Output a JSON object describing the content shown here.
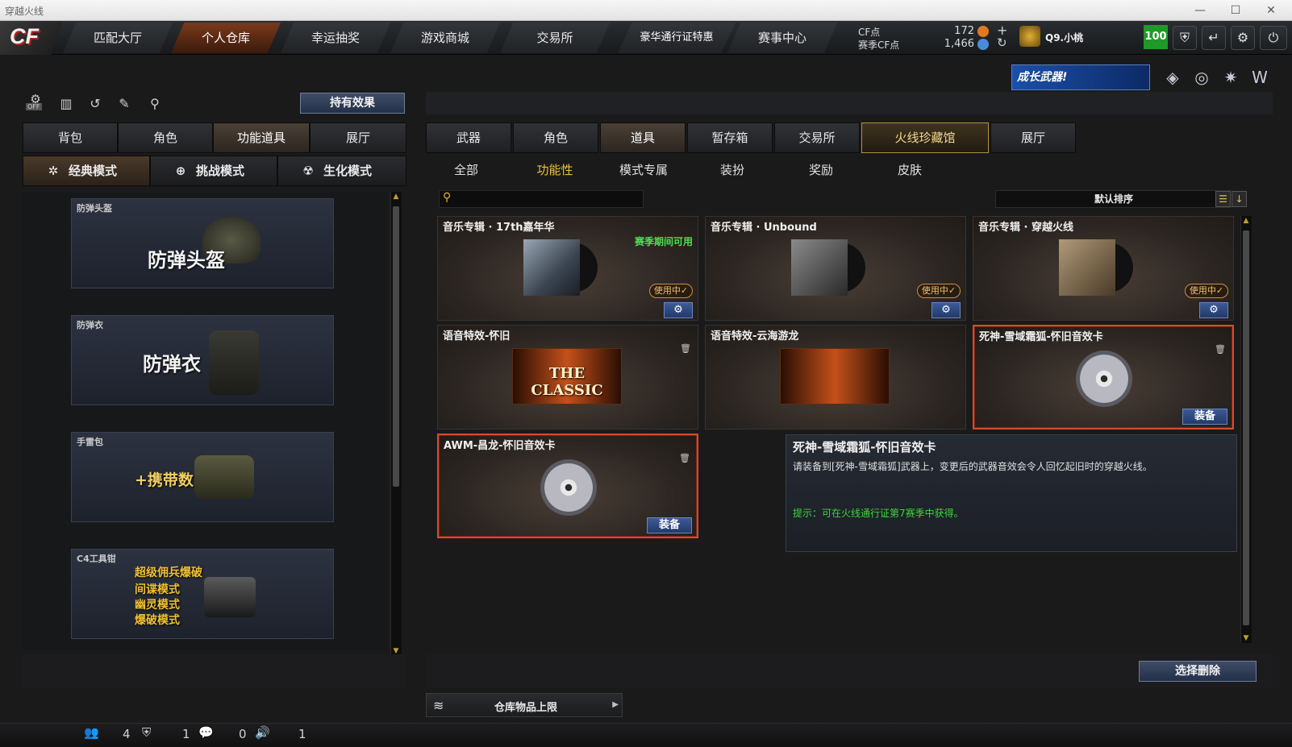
{
  "window": {
    "title": "穿越火线",
    "min": "—",
    "max": "☐",
    "close": "✕"
  },
  "nav": {
    "logo": "CF",
    "tabs": [
      "匹配大厅",
      "个人仓库",
      "幸运抽奖",
      "游戏商城",
      "交易所",
      "豪华通行证特惠",
      "赛事中心"
    ],
    "active_index": 1
  },
  "currency": {
    "cf_label": "CF点",
    "cf_value": "172",
    "season_label": "赛季CF点",
    "season_value": "1,466",
    "plus": "+",
    "refresh": "↻"
  },
  "user": {
    "name": "Q9.小桃",
    "level": "100"
  },
  "banner": {
    "text": "成长武器!"
  },
  "left": {
    "effect_button": "持有效果",
    "tabs": [
      "背包",
      "角色",
      "功能道具",
      "展厅"
    ],
    "mode_tabs": [
      "经典模式",
      "挑战模式",
      "生化模式"
    ],
    "items": [
      {
        "name": "防弹头盔",
        "text": "防弹头盔"
      },
      {
        "name": "防弹衣",
        "text": "防弹衣"
      },
      {
        "name": "手雷包",
        "text": "+携带数"
      },
      {
        "name": "C4工具钳",
        "lines": [
          "超级佣兵爆破",
          "间谍模式",
          "幽灵模式",
          "爆破模式"
        ]
      }
    ],
    "off_label": "OFF"
  },
  "right": {
    "tabs": [
      "武器",
      "角色",
      "道具",
      "暂存箱",
      "交易所",
      "火线珍藏馆",
      "展厅"
    ],
    "subtabs": [
      "全部",
      "功能性",
      "模式专属",
      "装扮",
      "奖励",
      "皮肤"
    ],
    "sort": "默认排序",
    "search_placeholder": "",
    "cards": [
      {
        "name": "音乐专辑 · 17th嘉年华",
        "season": "赛季期间可用",
        "status": "使用中✓"
      },
      {
        "name": "音乐专辑 · Unbound",
        "status": "使用中✓"
      },
      {
        "name": "音乐专辑 · 穿越火线",
        "status": "使用中✓"
      },
      {
        "name": "语音特效-怀旧",
        "art_text": "THE CLASSIC"
      },
      {
        "name": "语音特效-云海游龙"
      },
      {
        "name": "死神-雪域霜狐-怀旧音效卡",
        "equip": "装备"
      },
      {
        "name": "AWM-昌龙-怀旧音效卡",
        "equip": "装备"
      }
    ],
    "description": {
      "title": "死神-雪域霜狐-怀旧音效卡",
      "body": "请装备到[死神-雪域霜狐]武器上，变更后的武器音效会令人回忆起旧时的穿越火线。",
      "hint": "提示：可在火线通行证第7赛季中获得。"
    },
    "delete_button": "选择删除",
    "limit_label": "仓库物品上限"
  },
  "status": {
    "friends": "4",
    "clan": "1",
    "chat": "0",
    "volume": "1"
  }
}
